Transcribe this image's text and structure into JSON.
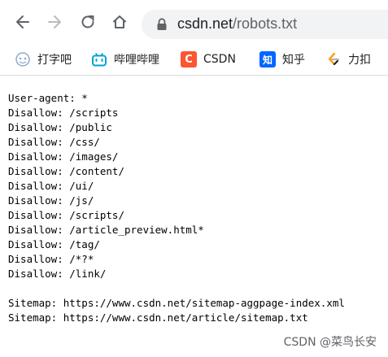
{
  "address_bar": {
    "domain": "csdn.net",
    "path": "/robots.txt"
  },
  "bookmarks": [
    {
      "label": "打字吧",
      "icon": "typing-bar-icon"
    },
    {
      "label": "哔哩哔哩",
      "icon": "bilibili-icon",
      "color": "#00a1d6"
    },
    {
      "label": "CSDN",
      "icon": "csdn-icon",
      "color": "#fc5531"
    },
    {
      "label": "知乎",
      "icon": "zhihu-icon",
      "color": "#0066ff"
    },
    {
      "label": "力扣",
      "icon": "leetcode-icon",
      "color": "#ffa116"
    }
  ],
  "robots": {
    "lines": [
      "User-agent: *",
      "Disallow: /scripts",
      "Disallow: /public",
      "Disallow: /css/",
      "Disallow: /images/",
      "Disallow: /content/",
      "Disallow: /ui/",
      "Disallow: /js/",
      "Disallow: /scripts/",
      "Disallow: /article_preview.html*",
      "Disallow: /tag/",
      "Disallow: /*?*",
      "Disallow: /link/"
    ],
    "sitemaps": [
      "Sitemap: https://www.csdn.net/sitemap-aggpage-index.xml",
      "Sitemap: https://www.csdn.net/article/sitemap.txt"
    ]
  },
  "watermark": "CSDN @菜鸟长安"
}
